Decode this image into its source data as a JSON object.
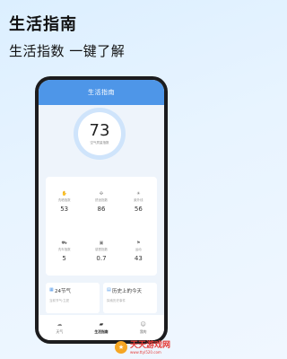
{
  "header": {
    "title": "生活指南",
    "subtitle": "生活指数 一键了解"
  },
  "app": {
    "topbar_title": "生活指南",
    "aqi": {
      "value": "73",
      "label": "空气质量指数"
    },
    "indices": [
      {
        "icon": "hand-icon",
        "label": "洗晒指数",
        "value": "53"
      },
      {
        "icon": "fan-icon",
        "label": "舒适指数",
        "value": "86"
      },
      {
        "icon": "uv-icon",
        "label": "紫外线",
        "value": "56"
      },
      {
        "icon": "car-icon",
        "label": "洗车指数",
        "value": "5"
      },
      {
        "icon": "cold-icon",
        "label": "感冒指数",
        "value": "0.7"
      },
      {
        "icon": "sport-icon",
        "label": "运动",
        "value": "43"
      }
    ],
    "cards": [
      {
        "title": "24节气",
        "subtitle": "当前节气:立夏"
      },
      {
        "title": "历史上的今天",
        "subtitle": "探索历史事件"
      }
    ],
    "tabs": [
      {
        "label": "天气",
        "active": false
      },
      {
        "label": "生活指南",
        "active": true
      },
      {
        "label": "我的",
        "active": false
      }
    ]
  },
  "watermark": {
    "name": "天天游戏网",
    "url": "www.ttyl520.com"
  }
}
